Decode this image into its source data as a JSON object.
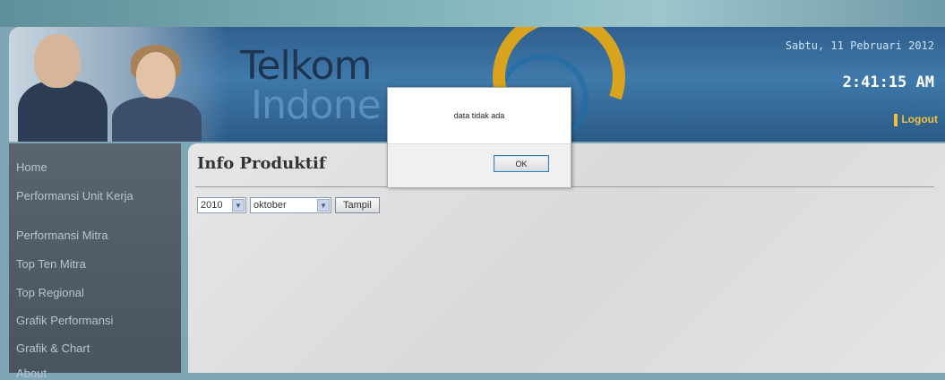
{
  "header": {
    "brand_line1": "Telkom",
    "brand_line2": "Indone",
    "date": "Sabtu, 11 Pebruari 2012",
    "time": "2:41:15 AM",
    "logout_label": "Logout"
  },
  "sidebar": {
    "items": [
      {
        "label": "Home"
      },
      {
        "label": "Performansi Unit Kerja"
      },
      {
        "label": "Performansi Mitra"
      },
      {
        "label": "Top Ten Mitra"
      },
      {
        "label": "Top Regional"
      },
      {
        "label": "Grafik Performansi"
      },
      {
        "label": "Grafik & Chart"
      },
      {
        "label": "About"
      }
    ]
  },
  "main": {
    "title": "Info Produktif",
    "year_select": "2010",
    "month_select": "oktober",
    "show_button": "Tampil"
  },
  "dialog": {
    "message": "data tidak ada",
    "ok_label": "OK"
  },
  "colors": {
    "sidebar_bg": "#505a66",
    "header_bg": "#3f79aa",
    "accent_gold": "#d9a31e"
  }
}
